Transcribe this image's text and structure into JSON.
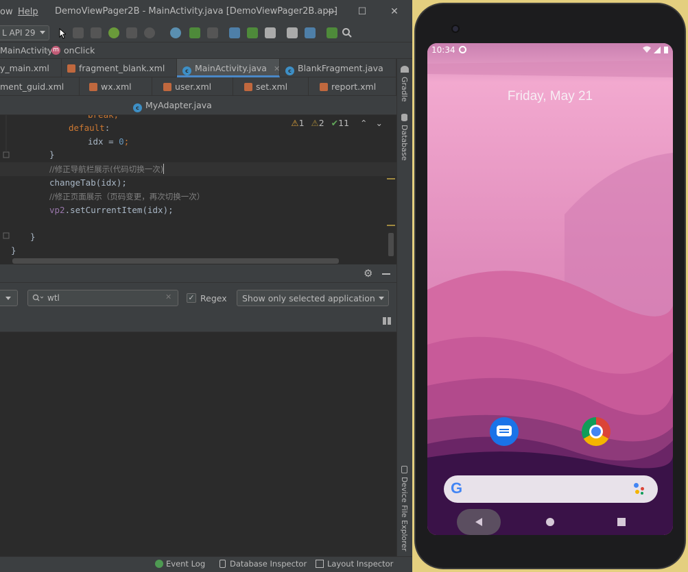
{
  "ide": {
    "menu": {
      "window_partial": "ow",
      "help": "Help"
    },
    "window_title": "DemoViewPager2B - MainActivity.java [DemoViewPager2B.app]",
    "window_controls": {
      "minimize": "—",
      "maximize": "☐",
      "close": "✕"
    },
    "toolbar": {
      "device_combo": "L API 29"
    },
    "breadcrumb": {
      "class_name": "MainActivity",
      "method_badge": "m",
      "method_name": "onClick"
    },
    "tab_rows": [
      [
        {
          "label": "y_main.xml",
          "type": "xml"
        },
        {
          "label": "fragment_blank.xml",
          "type": "xml"
        },
        {
          "label": "MainActivity.java",
          "type": "class",
          "active": true
        },
        {
          "label": "BlankFragment.java",
          "type": "class"
        }
      ],
      [
        {
          "label": "ment_guid.xml",
          "type": "xml"
        },
        {
          "label": "wx.xml",
          "type": "xml"
        },
        {
          "label": "user.xml",
          "type": "xml"
        },
        {
          "label": "set.xml",
          "type": "xml"
        },
        {
          "label": "report.xml",
          "type": "xml"
        }
      ],
      [
        {
          "label": "MyAdapter.java",
          "type": "class"
        }
      ]
    ],
    "inspections": {
      "warnings": "1",
      "weak_warnings": "2",
      "typos": "11"
    },
    "code": {
      "l0": "break;",
      "l1_kw": "default",
      "l1_colon": ":",
      "l2_var": "idx = ",
      "l2_num": "0",
      "l2_end": ";",
      "l3": "}",
      "l4": "//修正导航栏展示(代码切换一次)",
      "l5": "changeTab(idx);",
      "l6": "//修正页面展示（页码变更，再次切换一次）",
      "l7_field": "vp2",
      "l7_rest": ".setCurrentItem(idx);",
      "l9": "}",
      "l10": "}"
    },
    "logcat": {
      "search_value": "wtl",
      "regex_label": "Regex",
      "regex_checked": "✓",
      "filter_select": "Show only selected application"
    },
    "right_tools": {
      "gradle": "Gradle",
      "database": "Database",
      "device_file_explorer": "Device File Explorer"
    },
    "statusbar": {
      "event_log": "Event Log",
      "database_inspector": "Database Inspector",
      "layout_inspector": "Layout Inspector"
    }
  },
  "emulator": {
    "time": "10:34",
    "date": "Friday, May 21",
    "colors": {
      "accent_blue": "#1a73e8",
      "wallpaper_top": "#d47aa8",
      "wallpaper_bottom": "#3a1248"
    },
    "apps": [
      "messages-app-icon",
      "chrome-app-icon"
    ],
    "search_logo": "G"
  }
}
